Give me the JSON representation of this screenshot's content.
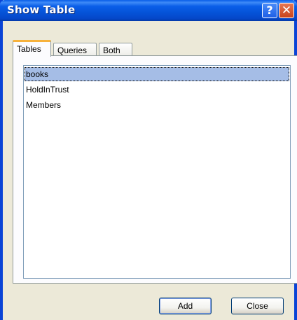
{
  "window": {
    "title": "Show Table"
  },
  "titlebar_buttons": {
    "help_glyph": "?",
    "close_glyph": "✕"
  },
  "tabs": [
    {
      "label": "Tables",
      "active": true
    },
    {
      "label": "Queries",
      "active": false
    },
    {
      "label": "Both",
      "active": false
    }
  ],
  "list": {
    "items": [
      {
        "label": "books",
        "selected": true
      },
      {
        "label": "HoldInTrust",
        "selected": false
      },
      {
        "label": "Members",
        "selected": false
      }
    ]
  },
  "buttons": {
    "add_label": "Add",
    "close_label": "Close"
  },
  "colors": {
    "titlebar": "#0a5ee8",
    "selection": "#a5bde6",
    "active_tab_accent": "#f7b23c",
    "close_button": "#c8431c"
  }
}
